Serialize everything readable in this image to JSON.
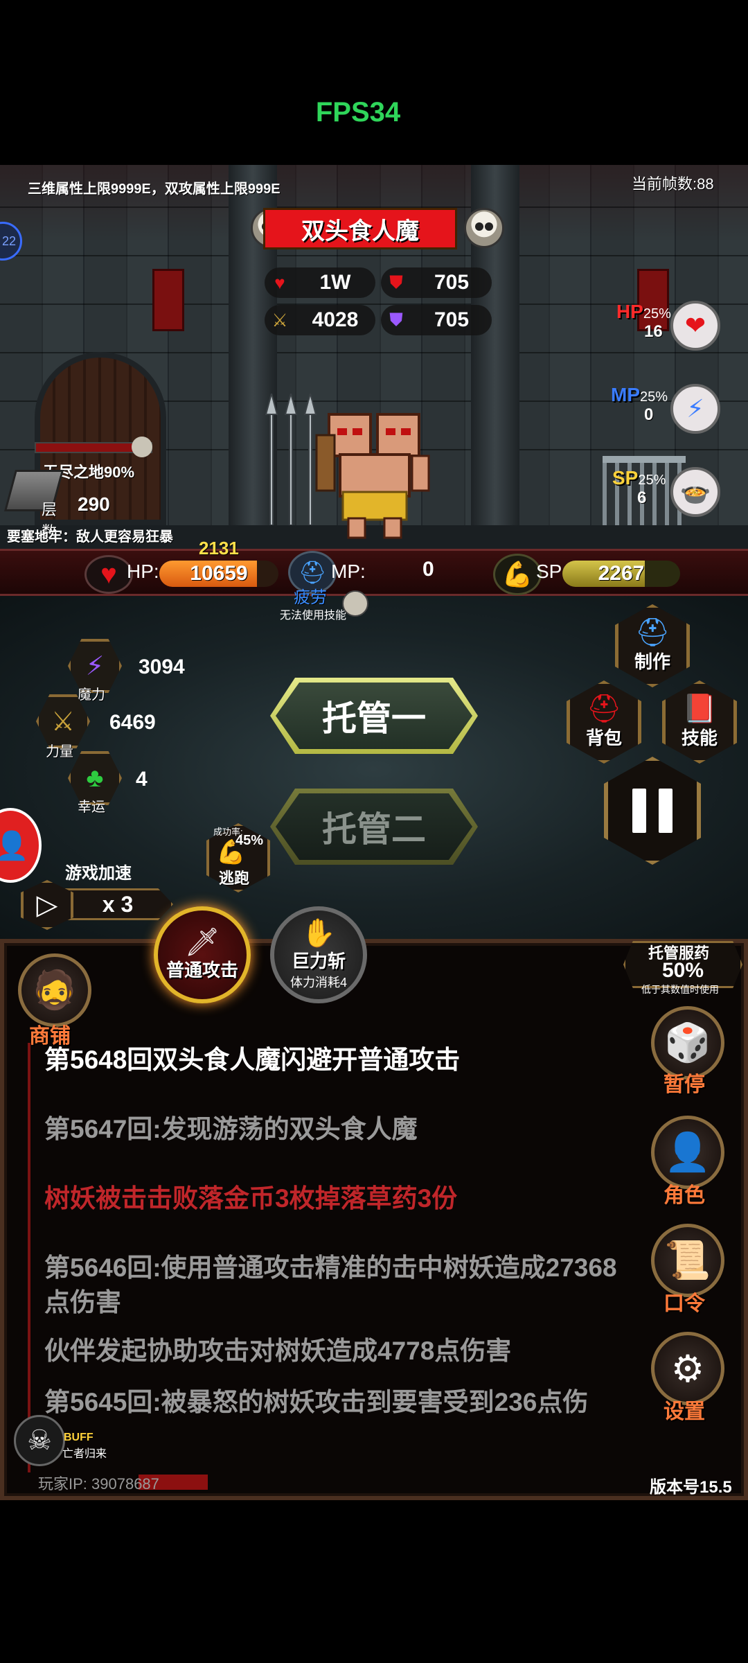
{
  "fps": "FPS34",
  "scene": {
    "limits_text": "三维属性上限9999E，双攻属性上限999E",
    "frame_count": "当前帧数:88",
    "side_badge": "22",
    "boss": {
      "name": "双头食人魔",
      "hp": "1W",
      "attack": "4028",
      "defense": "705",
      "magic_defense": "705"
    },
    "potions": [
      {
        "label": "HP",
        "pct": "25%",
        "count": "16",
        "color": "#ff2a2a",
        "icon": "heart-potion-icon"
      },
      {
        "label": "MP",
        "pct": "25%",
        "count": "0",
        "color": "#3a7cff",
        "icon": "mana-potion-icon"
      },
      {
        "label": "SP",
        "pct": "25%",
        "count": "6",
        "color": "#ffd23a",
        "icon": "stamina-food-icon"
      }
    ],
    "zone_name": "无尽之地90%",
    "floor_label": "层数",
    "floor_value": "290",
    "mode_text": "要塞地牢：敌人更容易狂暴"
  },
  "player": {
    "gold_popup": "2131",
    "hp_label": "HP:",
    "hp_value": "10659",
    "hp_fill": 0.82,
    "mp_label": "MP:",
    "mp_value": "0",
    "sp_label": "SP:",
    "sp_value": "2267",
    "sp_fill": 0.7,
    "fatigue_label": "疲劳",
    "fatigue_note": "无法使用技能"
  },
  "attributes": [
    {
      "name": "魔力",
      "value": "3094",
      "icon": "lightning-icon",
      "color": "#9b59ff"
    },
    {
      "name": "力量",
      "value": "6469",
      "icon": "sword-icon",
      "color": "#c9a23a"
    },
    {
      "name": "幸运",
      "value": "4",
      "icon": "clover-icon",
      "color": "#2ecc40"
    }
  ],
  "actions": {
    "auto1": "托管一",
    "auto2": "托管二",
    "escape_rate_label": "成功率:",
    "escape_rate": "45%",
    "escape_label": "逃跑",
    "speed_label": "游戏加速",
    "speed_value": "x 3",
    "craft": "制作",
    "bag": "背包",
    "skills": "技能"
  },
  "skills": {
    "normal_attack": "普通攻击",
    "giant_slash": "巨力斩",
    "giant_slash_cost": "体力消耗4"
  },
  "potion_auto": {
    "title": "托管服药",
    "value": "50%",
    "note": "低于其数值时使用"
  },
  "shop_label": "商铺",
  "side_buttons": [
    {
      "label": "暂停",
      "icon": "dice-icon"
    },
    {
      "label": "角色",
      "icon": "hooded-character-icon"
    },
    {
      "label": "口令",
      "icon": "scroll-icon"
    },
    {
      "label": "设置",
      "icon": "gear-icon"
    }
  ],
  "log": [
    {
      "text": "第5648回双头食人魔闪避开普通攻击",
      "color": "#ffffff"
    },
    {
      "text": "第5647回:发现游荡的双头食人魔",
      "color": "#9a9a9a"
    },
    {
      "text": "树妖被击击败落金币3枚掉落草药3份",
      "color": "#c0262a"
    },
    {
      "text": "第5646回:使用普通攻击精准的击中树妖造成27368点伤害",
      "color": "#9a9a9a"
    },
    {
      "text": "伙伴发起协助攻击对树妖造成4778点伤害",
      "color": "#9a9a9a"
    },
    {
      "text": "第5645回:被暴怒的树妖攻击到要害受到236点伤",
      "color": "#9a9a9a"
    }
  ],
  "buff": {
    "label": "BUFF",
    "sub": "亡者归来"
  },
  "footer": {
    "ip_label": "玩家IP: 39078687",
    "version": "版本号15.5"
  }
}
